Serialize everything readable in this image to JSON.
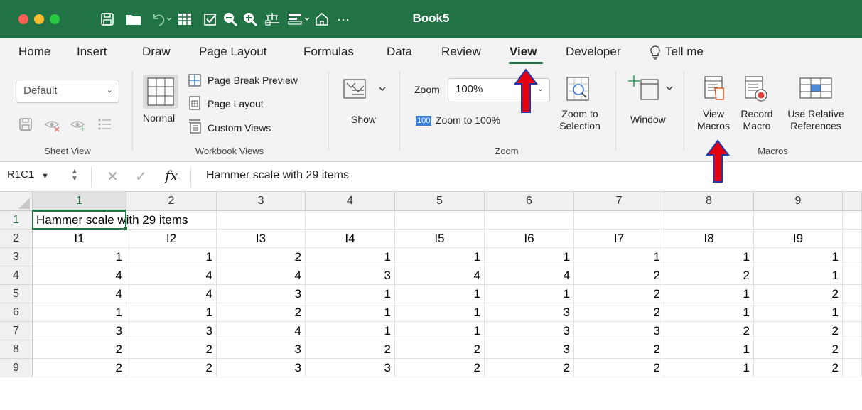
{
  "window": {
    "title": "Book5",
    "more_label": "···"
  },
  "tabs": [
    "Home",
    "Insert",
    "Draw",
    "Page Layout",
    "Formulas",
    "Data",
    "Review",
    "View",
    "Developer"
  ],
  "tell_me": "Tell me",
  "ribbon": {
    "sheet_view": {
      "dropdown_value": "Default",
      "group_label": "Sheet View"
    },
    "workbook_views": {
      "normal_label": "Normal",
      "page_break_label": "Page Break Preview",
      "page_layout_label": "Page Layout",
      "custom_views_label": "Custom Views",
      "group_label": "Workbook Views"
    },
    "show": {
      "label": "Show"
    },
    "zoom": {
      "zoom_label": "Zoom",
      "zoom_value": "100%",
      "zoom100_badge": "100",
      "zoom100_label": "Zoom to 100%",
      "zoom_selection_label": "Zoom to Selection",
      "group_label": "Zoom"
    },
    "window": {
      "label": "Window"
    },
    "macros": {
      "view_macros_label": "View Macros",
      "record_macro_label": "Record Macro",
      "relative_refs_label": "Use Relative References",
      "group_label": "Macros"
    }
  },
  "formula_bar": {
    "name_box": "R1C1",
    "fx_label": "fx",
    "content": "Hammer scale with 29 items"
  },
  "sheet": {
    "columns": [
      "1",
      "2",
      "3",
      "4",
      "5",
      "6",
      "7",
      "8",
      "9"
    ],
    "rows": [
      "1",
      "2",
      "3",
      "4",
      "5",
      "6",
      "7",
      "8",
      "9"
    ],
    "row1_text": "Hammer scale with 29 items",
    "headers": [
      "I1",
      "I2",
      "I3",
      "I4",
      "I5",
      "I6",
      "I7",
      "I8",
      "I9"
    ],
    "data": [
      [
        1,
        1,
        2,
        1,
        1,
        1,
        1,
        1,
        1
      ],
      [
        4,
        4,
        4,
        3,
        4,
        4,
        2,
        2,
        1
      ],
      [
        4,
        4,
        3,
        1,
        1,
        1,
        2,
        1,
        2
      ],
      [
        1,
        1,
        2,
        1,
        1,
        3,
        2,
        1,
        1
      ],
      [
        3,
        3,
        4,
        1,
        1,
        3,
        3,
        2,
        2
      ],
      [
        2,
        2,
        3,
        2,
        2,
        3,
        2,
        1,
        2
      ],
      [
        2,
        2,
        3,
        3,
        2,
        2,
        2,
        1,
        2
      ]
    ]
  },
  "colors": {
    "title_bar": "#217346",
    "accent": "#217346",
    "annotation_arrow": "#e3000f",
    "arrow_outline": "#1f3aa8"
  }
}
